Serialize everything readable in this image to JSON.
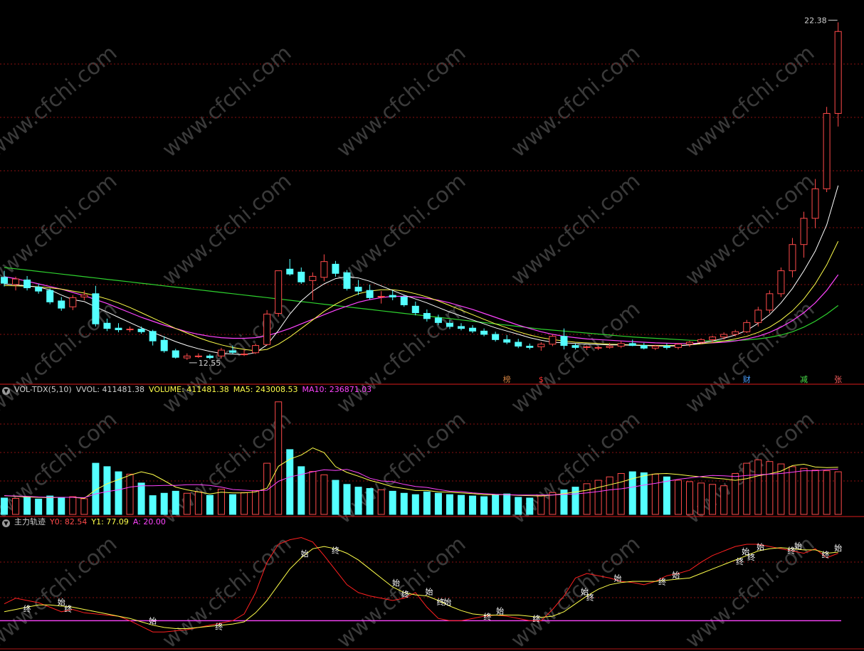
{
  "colors": {
    "background": "#000000",
    "up": "#ff4a4a",
    "down": "#54ffff",
    "ma_white": "#ffffff",
    "ma_yellow": "#ffff4a",
    "ma_magenta": "#ff44ff",
    "ma_green": "#2ed12e",
    "grid": "#8a1010",
    "separator": "#b01616",
    "watermark": "#3a3a3a"
  },
  "watermark_text": "www.cfchi.com",
  "price_panel": {
    "high_label": "22.38",
    "low_label": "12.55",
    "event_markers": [
      {
        "text": "榜",
        "bar": 44,
        "color": "#d08040"
      },
      {
        "text": "$",
        "bar": 47,
        "color": "#ff3030"
      },
      {
        "text": "财",
        "bar": 65,
        "color": "#4aa0ff"
      },
      {
        "text": "减",
        "bar": 70,
        "color": "#4ae04a"
      },
      {
        "text": "张",
        "bar": 73,
        "color": "#ff6060"
      }
    ]
  },
  "volume_panel": {
    "indicator_name": "VOL-TDX(5,10)",
    "vvol_label": "VVOL: 411481.38",
    "volume_label": "VOLUME: 411481.38",
    "ma5_label": "MA5: 243008.53",
    "ma10_label": "MA10: 236871.03"
  },
  "track_panel": {
    "indicator_name": "主力轨迹",
    "y0_label": "Y0: 82.54",
    "y1_label": "Y1: 77.09",
    "a_label": "A: 20.00",
    "start_char": "始",
    "end_char": "终",
    "a_level": 20,
    "signals": [
      {
        "bar": 2,
        "text": "终"
      },
      {
        "bar": 5,
        "text": "始"
      },
      {
        "bar": 5.6,
        "text": "终"
      },
      {
        "bar": 13,
        "text": "始"
      },
      {
        "bar": 18.8,
        "text": "终"
      },
      {
        "bar": 26.3,
        "text": "始"
      },
      {
        "bar": 29,
        "text": "终"
      },
      {
        "bar": 34.3,
        "text": "始"
      },
      {
        "bar": 35.1,
        "text": "终"
      },
      {
        "bar": 37.2,
        "text": "始"
      },
      {
        "bar": 38.2,
        "text": "终"
      },
      {
        "bar": 38.8,
        "text": "始"
      },
      {
        "bar": 42.3,
        "text": "终"
      },
      {
        "bar": 43.4,
        "text": "始"
      },
      {
        "bar": 46.6,
        "text": "终"
      },
      {
        "bar": 50.8,
        "text": "始"
      },
      {
        "bar": 51.3,
        "text": "终"
      },
      {
        "bar": 53.7,
        "text": "始"
      },
      {
        "bar": 57.6,
        "text": "终"
      },
      {
        "bar": 58.8,
        "text": "始"
      },
      {
        "bar": 64.4,
        "text": "终"
      },
      {
        "bar": 64.9,
        "text": "始"
      },
      {
        "bar": 65.4,
        "text": "终"
      },
      {
        "bar": 66.2,
        "text": "始"
      },
      {
        "bar": 68.9,
        "text": "终"
      },
      {
        "bar": 69.5,
        "text": "始"
      },
      {
        "bar": 71.9,
        "text": "终"
      },
      {
        "bar": 73,
        "text": "始"
      }
    ]
  },
  "chart_data": {
    "type": "candlestick",
    "bar_count": 74,
    "ohlc": [
      [
        14.6,
        14.8,
        14.32,
        14.42
      ],
      [
        14.38,
        14.62,
        14.2,
        14.55
      ],
      [
        14.52,
        14.64,
        14.2,
        14.28
      ],
      [
        14.3,
        14.4,
        14.1,
        14.18
      ],
      [
        14.2,
        14.26,
        13.78,
        13.85
      ],
      [
        13.88,
        14.0,
        13.58,
        13.66
      ],
      [
        13.7,
        14.06,
        13.6,
        13.98
      ],
      [
        14.0,
        14.2,
        13.9,
        14.06
      ],
      [
        14.1,
        14.34,
        13.1,
        13.18
      ],
      [
        13.2,
        13.34,
        12.96,
        13.04
      ],
      [
        13.05,
        13.2,
        12.92,
        13.0
      ],
      [
        13.0,
        13.1,
        12.93,
        13.02
      ],
      [
        13.02,
        13.1,
        12.88,
        12.94
      ],
      [
        12.95,
        13.0,
        12.52,
        12.66
      ],
      [
        12.68,
        12.8,
        12.3,
        12.36
      ],
      [
        12.36,
        12.42,
        12.12,
        12.16
      ],
      [
        12.14,
        12.28,
        12.08,
        12.2
      ],
      [
        12.2,
        12.28,
        12.14,
        12.2
      ],
      [
        12.2,
        12.26,
        12.1,
        12.15
      ],
      [
        12.2,
        12.45,
        12.12,
        12.38
      ],
      [
        12.36,
        12.52,
        12.26,
        12.31
      ],
      [
        12.26,
        12.4,
        12.2,
        12.26
      ],
      [
        12.3,
        12.58,
        12.26,
        12.52
      ],
      [
        12.55,
        13.6,
        12.52,
        13.48
      ],
      [
        13.5,
        14.8,
        13.4,
        14.8
      ],
      [
        14.85,
        15.16,
        14.65,
        14.7
      ],
      [
        14.76,
        14.9,
        14.4,
        14.46
      ],
      [
        14.5,
        14.75,
        13.9,
        14.63
      ],
      [
        14.6,
        15.3,
        14.48,
        15.08
      ],
      [
        15.0,
        15.1,
        14.62,
        14.72
      ],
      [
        14.74,
        14.82,
        14.2,
        14.26
      ],
      [
        14.3,
        14.52,
        14.06,
        14.18
      ],
      [
        14.2,
        14.38,
        13.92,
        13.98
      ],
      [
        14.0,
        14.18,
        13.8,
        14.02
      ],
      [
        14.05,
        14.2,
        13.9,
        14.0
      ],
      [
        14.0,
        14.06,
        13.7,
        13.76
      ],
      [
        13.72,
        13.86,
        13.44,
        13.52
      ],
      [
        13.5,
        13.62,
        13.25,
        13.34
      ],
      [
        13.36,
        13.46,
        13.14,
        13.22
      ],
      [
        13.2,
        13.3,
        13.02,
        13.1
      ],
      [
        13.1,
        13.2,
        12.98,
        13.04
      ],
      [
        13.05,
        13.14,
        12.9,
        12.96
      ],
      [
        12.96,
        13.04,
        12.8,
        12.86
      ],
      [
        12.86,
        12.94,
        12.64,
        12.7
      ],
      [
        12.7,
        12.84,
        12.56,
        12.62
      ],
      [
        12.62,
        12.72,
        12.44,
        12.5
      ],
      [
        12.5,
        12.58,
        12.4,
        12.46
      ],
      [
        12.48,
        12.62,
        12.36,
        12.56
      ],
      [
        12.56,
        12.86,
        12.5,
        12.8
      ],
      [
        12.8,
        13.04,
        12.4,
        12.52
      ],
      [
        12.52,
        12.58,
        12.4,
        12.46
      ],
      [
        12.46,
        12.52,
        12.38,
        12.48
      ],
      [
        12.44,
        12.5,
        12.38,
        12.46
      ],
      [
        12.46,
        12.6,
        12.42,
        12.5
      ],
      [
        12.5,
        12.66,
        12.44,
        12.58
      ],
      [
        12.58,
        12.7,
        12.5,
        12.52
      ],
      [
        12.52,
        12.6,
        12.4,
        12.44
      ],
      [
        12.44,
        12.54,
        12.38,
        12.5
      ],
      [
        12.5,
        12.58,
        12.4,
        12.46
      ],
      [
        12.46,
        12.6,
        12.4,
        12.56
      ],
      [
        12.56,
        12.66,
        12.48,
        12.62
      ],
      [
        12.62,
        12.74,
        12.56,
        12.7
      ],
      [
        12.7,
        12.82,
        12.6,
        12.78
      ],
      [
        12.78,
        12.92,
        12.7,
        12.86
      ],
      [
        12.86,
        13.0,
        12.8,
        12.94
      ],
      [
        12.94,
        13.3,
        12.9,
        13.22
      ],
      [
        13.22,
        13.7,
        13.1,
        13.6
      ],
      [
        13.6,
        14.2,
        13.5,
        14.1
      ],
      [
        14.1,
        14.9,
        14.0,
        14.8
      ],
      [
        14.8,
        15.8,
        14.6,
        15.6
      ],
      [
        15.6,
        16.6,
        15.2,
        16.4
      ],
      [
        16.4,
        17.6,
        16.1,
        17.3
      ],
      [
        17.3,
        19.8,
        17.2,
        19.6
      ],
      [
        19.6,
        22.38,
        19.2,
        22.1
      ]
    ],
    "volume": [
      48,
      47,
      50,
      45,
      54,
      48,
      52,
      46,
      150,
      140,
      125,
      118,
      92,
      55,
      62,
      68,
      62,
      66,
      56,
      74,
      58,
      64,
      70,
      150,
      330,
      190,
      140,
      126,
      116,
      100,
      88,
      80,
      76,
      72,
      68,
      62,
      58,
      66,
      62,
      58,
      56,
      54,
      52,
      58,
      60,
      50,
      48,
      56,
      64,
      72,
      80,
      90,
      100,
      110,
      120,
      125,
      122,
      118,
      110,
      100,
      96,
      92,
      88,
      84,
      120,
      150,
      160,
      155,
      148,
      140,
      135,
      130,
      128,
      125
    ],
    "vol_ma5": [
      55,
      53,
      51,
      50,
      49,
      50,
      50,
      47,
      72,
      90,
      102,
      115,
      125,
      117,
      99,
      80,
      72,
      66,
      60,
      65,
      63,
      63,
      66,
      77,
      141,
      162,
      174,
      195,
      181,
      140,
      123,
      112,
      100,
      91,
      81,
      76,
      70,
      70,
      66,
      65,
      63,
      61,
      58,
      58,
      58,
      56,
      55,
      54,
      57,
      61,
      66,
      71,
      79,
      87,
      95,
      105,
      113,
      119,
      120,
      117,
      113,
      110,
      107,
      104,
      100,
      105,
      113,
      119,
      127,
      143,
      147,
      139,
      137,
      138
    ],
    "vol_ma10": [
      55,
      54,
      53,
      51,
      50,
      50,
      50,
      49,
      60,
      67,
      72,
      80,
      84,
      84,
      85,
      85,
      87,
      87,
      85,
      80,
      73,
      71,
      69,
      71,
      97,
      110,
      117,
      125,
      131,
      129,
      132,
      122,
      106,
      98,
      96,
      88,
      82,
      79,
      73,
      68,
      67,
      63,
      61,
      59,
      58,
      57,
      57,
      57,
      57,
      59,
      60,
      63,
      67,
      72,
      75,
      80,
      86,
      91,
      97,
      103,
      107,
      111,
      114,
      113,
      111,
      114,
      116,
      118,
      120,
      124,
      128,
      128,
      131,
      133
    ],
    "track_y0": [
      35,
      40,
      38,
      36,
      32,
      28,
      30,
      27,
      26,
      25,
      24,
      20,
      15,
      10,
      10,
      11,
      12,
      14,
      16,
      18,
      20,
      26,
      45,
      72,
      88,
      92,
      94,
      90,
      78,
      65,
      52,
      45,
      42,
      40,
      38,
      40,
      45,
      32,
      22,
      20,
      20,
      22,
      24,
      25,
      24,
      22,
      20,
      20,
      30,
      42,
      58,
      62,
      60,
      58,
      55,
      54,
      52,
      55,
      60,
      62,
      65,
      72,
      78,
      82,
      86,
      88,
      88,
      86,
      84,
      82,
      80,
      84,
      76,
      80
    ],
    "track_y1": [
      28,
      30,
      32,
      34,
      34,
      33,
      32,
      30,
      28,
      26,
      24,
      22,
      19,
      16,
      14,
      13,
      13,
      14,
      15,
      16,
      17,
      19,
      27,
      38,
      52,
      66,
      76,
      84,
      86,
      84,
      80,
      74,
      66,
      58,
      50,
      45,
      43,
      42,
      38,
      33,
      29,
      26,
      25,
      25,
      25,
      25,
      24,
      23,
      24,
      28,
      35,
      42,
      48,
      52,
      54,
      55,
      55,
      55,
      56,
      57,
      58,
      62,
      66,
      70,
      74,
      78,
      82,
      84,
      85,
      84,
      83,
      83,
      80,
      81
    ],
    "ma_white_line": [
      14.4,
      14.37,
      14.34,
      14.3,
      14.22,
      14.06,
      13.92,
      13.86,
      13.7,
      13.54,
      13.38,
      13.22,
      13.06,
      12.92,
      12.78,
      12.64,
      12.52,
      12.42,
      12.34,
      12.28,
      12.26,
      12.24,
      12.3,
      12.54,
      12.98,
      13.48,
      13.88,
      14.18,
      14.4,
      14.56,
      14.62,
      14.58,
      14.48,
      14.34,
      14.2,
      14.06,
      13.94,
      13.82,
      13.68,
      13.54,
      13.42,
      13.3,
      13.18,
      13.06,
      12.96,
      12.86,
      12.76,
      12.68,
      12.62,
      12.6,
      12.58,
      12.56,
      12.55,
      12.54,
      12.54,
      12.53,
      12.52,
      12.51,
      12.5,
      12.51,
      12.54,
      12.6,
      12.66,
      12.74,
      12.84,
      12.98,
      13.2,
      13.46,
      13.82,
      14.26,
      14.8,
      15.4,
      16.2,
      17.4
    ],
    "ma_yellow_line": [
      14.35,
      14.34,
      14.33,
      14.31,
      14.28,
      14.24,
      14.18,
      14.12,
      14.04,
      13.94,
      13.82,
      13.68,
      13.52,
      13.36,
      13.2,
      13.04,
      12.9,
      12.76,
      12.64,
      12.54,
      12.46,
      12.4,
      12.36,
      12.4,
      12.56,
      12.78,
      13.04,
      13.3,
      13.56,
      13.78,
      13.96,
      14.1,
      14.18,
      14.22,
      14.22,
      14.18,
      14.1,
      14.0,
      13.88,
      13.74,
      13.6,
      13.46,
      13.32,
      13.18,
      13.06,
      12.94,
      12.84,
      12.76,
      12.7,
      12.66,
      12.62,
      12.6,
      12.58,
      12.56,
      12.55,
      12.54,
      12.53,
      12.52,
      12.52,
      12.52,
      12.54,
      12.57,
      12.61,
      12.66,
      12.72,
      12.8,
      12.92,
      13.08,
      13.3,
      13.58,
      13.94,
      14.4,
      14.98,
      15.7
    ],
    "ma_magenta_line": [
      14.62,
      14.56,
      14.48,
      14.4,
      14.32,
      14.24,
      14.14,
      14.04,
      13.92,
      13.8,
      13.66,
      13.52,
      13.38,
      13.26,
      13.14,
      13.04,
      12.94,
      12.86,
      12.8,
      12.76,
      12.74,
      12.74,
      12.76,
      12.82,
      12.92,
      13.04,
      13.18,
      13.32,
      13.46,
      13.6,
      13.72,
      13.84,
      13.92,
      13.98,
      14.02,
      14.02,
      14.0,
      13.96,
      13.9,
      13.82,
      13.72,
      13.62,
      13.5,
      13.38,
      13.26,
      13.14,
      13.04,
      12.94,
      12.86,
      12.8,
      12.76,
      12.72,
      12.7,
      12.68,
      12.66,
      12.64,
      12.62,
      12.6,
      12.59,
      12.58,
      12.58,
      12.59,
      12.6,
      12.62,
      12.66,
      12.72,
      12.8,
      12.92,
      13.08,
      13.28,
      13.52,
      13.82,
      14.2,
      14.68
    ],
    "ma_green_line": [
      14.9,
      14.86,
      14.82,
      14.78,
      14.74,
      14.7,
      14.66,
      14.62,
      14.58,
      14.54,
      14.5,
      14.46,
      14.42,
      14.38,
      14.34,
      14.3,
      14.26,
      14.22,
      14.18,
      14.14,
      14.1,
      14.06,
      14.02,
      13.98,
      13.94,
      13.9,
      13.86,
      13.82,
      13.78,
      13.74,
      13.7,
      13.66,
      13.62,
      13.58,
      13.54,
      13.5,
      13.46,
      13.42,
      13.38,
      13.34,
      13.3,
      13.26,
      13.22,
      13.18,
      13.14,
      13.1,
      13.06,
      13.02,
      12.99,
      12.96,
      12.93,
      12.9,
      12.87,
      12.84,
      12.81,
      12.78,
      12.76,
      12.74,
      12.72,
      12.7,
      12.68,
      12.67,
      12.66,
      12.66,
      12.67,
      12.69,
      12.72,
      12.77,
      12.84,
      12.94,
      13.08,
      13.26,
      13.48,
      13.74
    ],
    "price_range": [
      11.6,
      22.8
    ],
    "volume_range": [
      0,
      340
    ],
    "track_range": [
      0,
      100
    ]
  }
}
